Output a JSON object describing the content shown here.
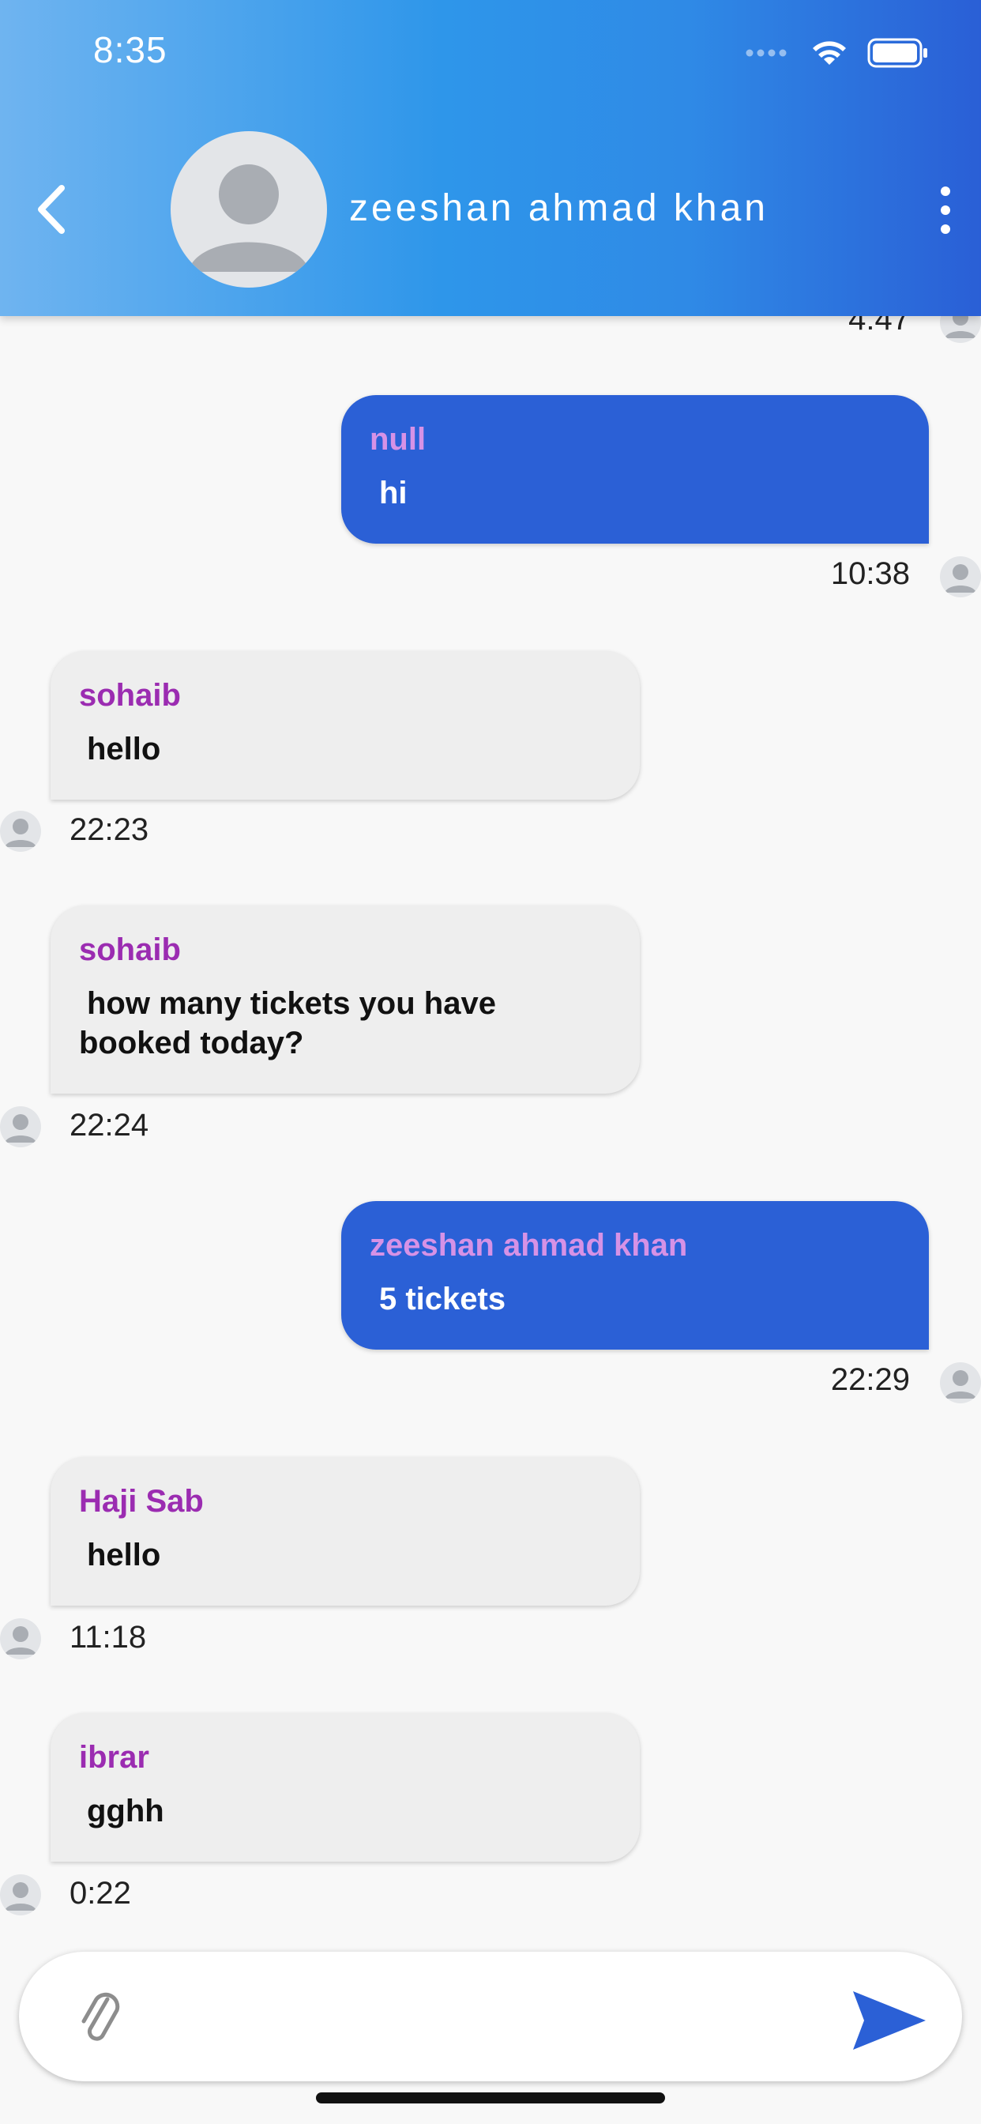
{
  "status_bar": {
    "time": "8:35"
  },
  "header": {
    "contact_name": "zeeshan ahmad khan"
  },
  "chat": {
    "top_time": "4:47",
    "messages": [
      {
        "direction": "out",
        "sender": "null",
        "text": "hi",
        "time": "10:38"
      },
      {
        "direction": "in",
        "sender": "sohaib",
        "text": "hello",
        "time": "22:23"
      },
      {
        "direction": "in",
        "sender": "sohaib",
        "text": "how many tickets you have booked today?",
        "time": "22:24"
      },
      {
        "direction": "out",
        "sender": "zeeshan ahmad khan",
        "text": "5 tickets",
        "time": "22:29"
      },
      {
        "direction": "in",
        "sender": "Haji Sab",
        "text": "hello",
        "time": "11:18"
      },
      {
        "direction": "in",
        "sender": "ibrar",
        "text": "gghh",
        "time": "0:22"
      }
    ]
  },
  "composer": {
    "value": "",
    "placeholder": ""
  },
  "colors": {
    "outgoing_bubble": "#2b60d6",
    "incoming_bubble": "#eeeeee",
    "sender_name": "#9b2cb1",
    "header_accent": "#2e96ea"
  }
}
